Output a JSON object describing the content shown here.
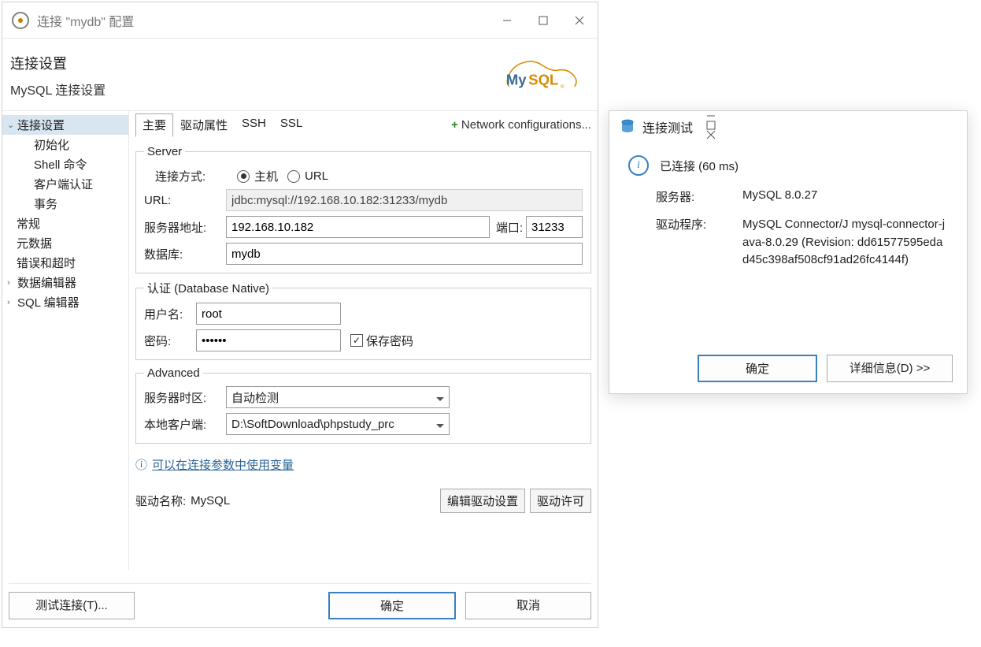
{
  "mainWindow": {
    "title": "连接 \"mydb\" 配置",
    "heading": "连接设置",
    "subheading": "MySQL 连接设置",
    "logoText": "MySQL",
    "nav": {
      "connectionSettings": "连接设置",
      "init": "初始化",
      "shell": "Shell 命令",
      "clientAuth": "客户端认证",
      "transaction": "事务",
      "general": "常规",
      "metadata": "元数据",
      "errorsTimeout": "错误和超时",
      "dataEditor": "数据编辑器",
      "sqlEditor": "SQL 编辑器"
    },
    "tabs": {
      "main": "主要",
      "driverProps": "驱动属性",
      "ssh": "SSH",
      "ssl": "SSL",
      "networkConfigs": "Network configurations..."
    },
    "server": {
      "legend": "Server",
      "connectByLabel": "连接方式:",
      "hostRadio": "主机",
      "urlRadio": "URL",
      "urlLabel": "URL:",
      "urlValue": "jdbc:mysql://192.168.10.182:31233/mydb",
      "hostLabel": "服务器地址:",
      "hostValue": "192.168.10.182",
      "portLabel": "端口:",
      "portValue": "31233",
      "dbLabel": "数据库:",
      "dbValue": "mydb"
    },
    "auth": {
      "legend": "认证 (Database Native)",
      "userLabel": "用户名:",
      "userValue": "root",
      "passLabel": "密码:",
      "passValue": "••••••",
      "savePassLabel": "保存密码"
    },
    "advanced": {
      "legend": "Advanced",
      "tzLabel": "服务器时区:",
      "tzValue": "自动检测",
      "localClientLabel": "本地客户端:",
      "localClientValue": "D:\\SoftDownload\\phpstudy_prc"
    },
    "paramLinkText": "可以在连接参数中使用变量",
    "driverNameLabel": "驱动名称:",
    "driverName": "MySQL",
    "editDriverBtn": "编辑驱动设置",
    "driverLicenseBtn": "驱动许可",
    "testBtn": "测试连接(T)...",
    "okBtn": "确定",
    "cancelBtn": "取消"
  },
  "testWindow": {
    "title": "连接测试",
    "statusText": "已连接 (60 ms)",
    "serverLabel": "服务器:",
    "serverValue": "MySQL 8.0.27",
    "driverLabel": "驱动程序:",
    "driverValue": "MySQL Connector/J mysql-connector-java-8.0.29 (Revision: dd61577595edad45c398af508cf91ad26fc4144f)",
    "okBtn": "确定",
    "detailsBtn": "详细信息(D) >>"
  }
}
